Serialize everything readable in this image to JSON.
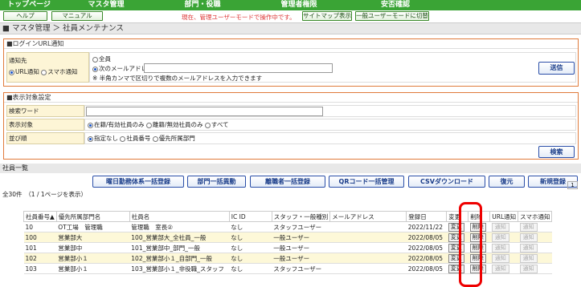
{
  "topnav": [
    "トップページ",
    "マスタ管理",
    "部門・役職",
    "管理者権限",
    "安否確認"
  ],
  "help": "ヘルプ",
  "manual": "マニュアル",
  "warning": "現在、管理ユーザーモードで操作中です。",
  "sitemap": "サイトマップ表示",
  "switch_mode": "一般ユーザーモードに切替",
  "breadcrumb": "■ マスタ管理 ＞ 社員メンテナンス",
  "login_panel": {
    "title": "■ログインURL通知",
    "label": "通知先",
    "url_notice": "URL通知",
    "smart_notice": "スマホ通知",
    "all": "全員",
    "following": "次のメールアドレス",
    "note": "※ 半角カンマで区切りで複数のメールアドレスを入力できます",
    "send": "送信",
    "email_value": ""
  },
  "display_panel": {
    "title": "■表示対象設定",
    "keyword_label": "検索ワード",
    "keyword_value": "",
    "target_label": "表示対象",
    "target_opts": [
      "在籍/有効社員のみ",
      "離籍/無効社員のみ",
      "すべて"
    ],
    "order_label": "並び順",
    "order_opts": [
      "指定なし",
      "社員番号",
      "優先所属部門"
    ],
    "search": "検索"
  },
  "section": "社員一覧",
  "buttons": [
    "曜日勤務体系一括登録",
    "部門一括異動",
    "離職者一括登録",
    "QRコード一括管理",
    "CSVダウンロード",
    "復元",
    "新規登録"
  ],
  "count": "全30件　（1 / 1ページを表示）",
  "page": "1",
  "table": {
    "headers": [
      "社員番号▲",
      "優先所属部門名",
      "社員名",
      "IC ID",
      "スタッフ・一般種別",
      "メールアドレス",
      "登録日",
      "変更",
      "削除",
      "URL通知",
      "スマホ通知"
    ],
    "rows": [
      [
        "10",
        "OT工場　管理職",
        "管理職　室長②",
        "なし",
        "スタッフユーザー",
        "",
        "2022/11/22"
      ],
      [
        "100",
        "営業部大",
        "100_営業部大_全社員_一般",
        "なし",
        "一般ユーザー",
        "",
        "2022/08/05"
      ],
      [
        "101",
        "営業部中",
        "101_営業部中_部門_一般",
        "なし",
        "一般ユーザー",
        "",
        "2022/08/05"
      ],
      [
        "102",
        "営業部小１",
        "102_営業部小１_自部門_一般",
        "なし",
        "一般ユーザー",
        "",
        "2022/08/05"
      ],
      [
        "103",
        "営業部小１",
        "103_営業部小１_非役職_スタッフ",
        "なし",
        "スタッフユーザー",
        "",
        "2022/08/05"
      ]
    ],
    "change": "変更",
    "delete": "削除",
    "notify": "通知"
  }
}
